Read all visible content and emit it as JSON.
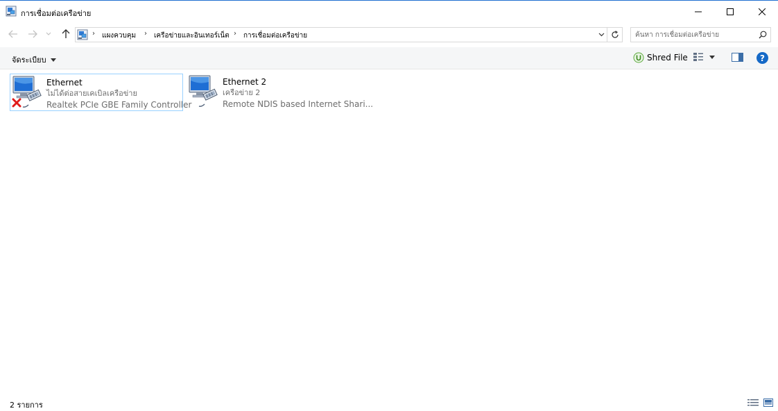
{
  "window": {
    "title": "การเชื่อมต่อเครือข่าย"
  },
  "address": {
    "breadcrumbs": [
      "แผงควบคุม",
      "เครือข่ายและอินเทอร์เน็ต",
      "การเชื่อมต่อเครือข่าย"
    ]
  },
  "search": {
    "placeholder": "ค้นหา การเชื่อมต่อเครือข่าย"
  },
  "toolbar": {
    "organize_label": "จัดระเบียบ",
    "shred_label": "Shred File"
  },
  "connections": [
    {
      "name": "Ethernet",
      "status": "ไม่ได้ต่อสายเคเบิลเครือข่าย",
      "device": "Realtek PCIe GBE Family Controller",
      "disconnected": true,
      "selected": true
    },
    {
      "name": "Ethernet 2",
      "status": "เครือข่าย  2",
      "device": "Remote NDIS based Internet Shari...",
      "disconnected": false,
      "selected": false
    }
  ],
  "statusbar": {
    "item_count": "2 รายการ"
  },
  "colors": {
    "accent": "#1569c7",
    "selection_border": "#99d1ff",
    "secondary_text": "#6d6d6d"
  },
  "icons": [
    "network-adapter-icon",
    "disconnected-x-icon",
    "search-icon",
    "refresh-icon",
    "help-icon",
    "shred-icon"
  ]
}
